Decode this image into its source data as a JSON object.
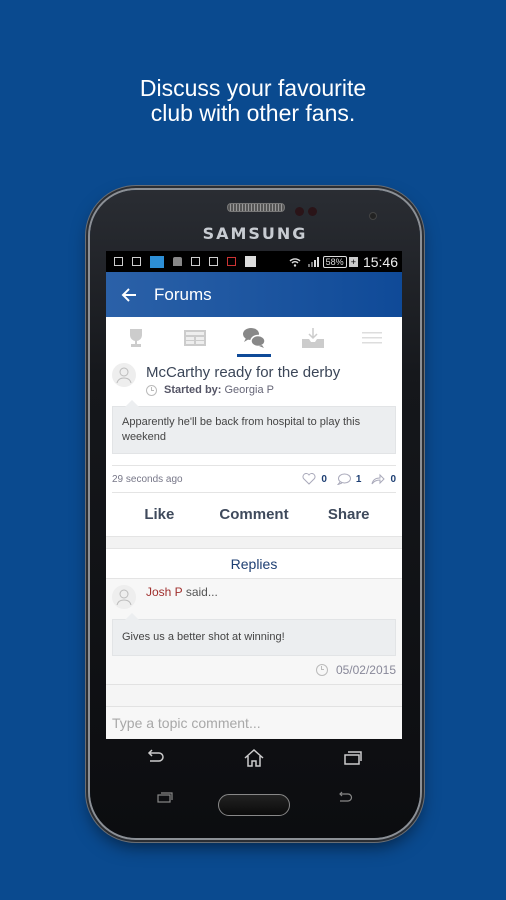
{
  "headline": {
    "line1": "Discuss your favourite",
    "line2": "club with other fans."
  },
  "device": {
    "brand": "SAMSUNG"
  },
  "status_bar": {
    "left_icons": [
      "screenshot-icon",
      "gallery-icon",
      "app-thumbnail-icon",
      "shirt-icon",
      "checkbox-icon",
      "screenshot-icon",
      "signal-x-icon",
      "play-store-icon"
    ],
    "battery": "58%",
    "time": "15:46"
  },
  "app_bar": {
    "back_icon": "arrow-left-icon",
    "title": "Forums"
  },
  "tabs": [
    {
      "icon": "trophy-icon",
      "active": false
    },
    {
      "icon": "news-icon",
      "active": false
    },
    {
      "icon": "chat-bubbles-icon",
      "active": true
    },
    {
      "icon": "download-tray-icon",
      "active": false
    },
    {
      "icon": "menu-icon",
      "active": false
    }
  ],
  "post": {
    "title": "McCarthy ready for the derby",
    "started_by_label": "Started by:",
    "author": "Georgia P",
    "body": "Apparently he'll be back from hospital to play this weekend",
    "time_ago": "29 seconds ago",
    "likes": "0",
    "comments": "1",
    "shares": "0",
    "actions": {
      "like": "Like",
      "comment": "Comment",
      "share": "Share"
    }
  },
  "replies": {
    "header": "Replies",
    "items": [
      {
        "author": "Josh P",
        "said": "said...",
        "body": "Gives us a better shot at winning!",
        "date": "05/02/2015"
      }
    ]
  },
  "comment_input": {
    "placeholder": "Type a topic comment...",
    "value": ""
  },
  "colors": {
    "background": "#0a4a8f",
    "app_bar": "#0f4a98",
    "accent_tab": "#0f4a98",
    "reply_author": "#a0302e",
    "stat_count": "#1e3f73"
  }
}
